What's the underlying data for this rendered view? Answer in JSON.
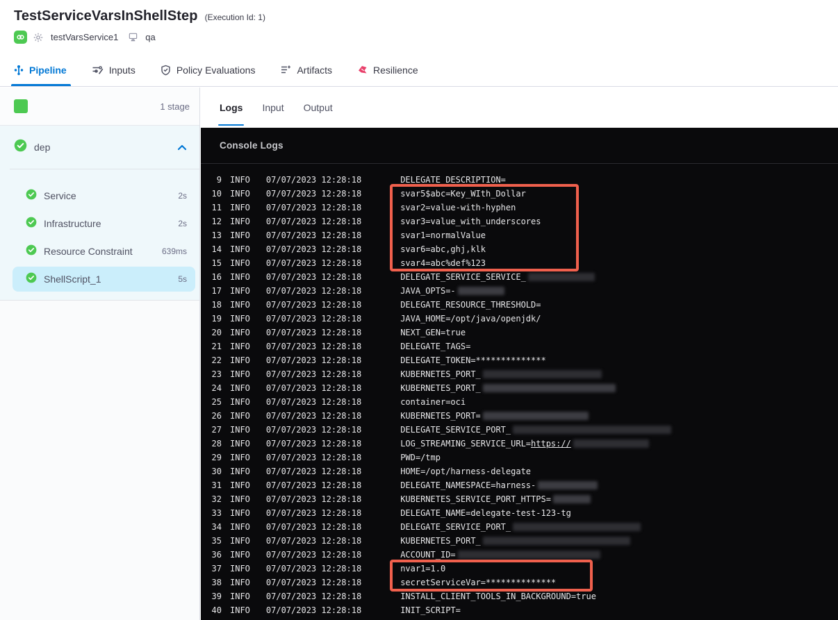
{
  "header": {
    "title": "TestServiceVarsInShellStep",
    "execution_id": "(Execution Id: 1)",
    "service_name": "testVarsService1",
    "environment_name": "qa"
  },
  "tabs": [
    {
      "label": "Pipeline",
      "active": true
    },
    {
      "label": "Inputs",
      "active": false
    },
    {
      "label": "Policy Evaluations",
      "active": false
    },
    {
      "label": "Artifacts",
      "active": false
    },
    {
      "label": "Resilience",
      "active": false
    }
  ],
  "sidebar": {
    "stage_count": "1 stage",
    "stage_name": "dep",
    "steps": [
      {
        "label": "Service",
        "duration": "2s",
        "selected": false
      },
      {
        "label": "Infrastructure",
        "duration": "2s",
        "selected": false
      },
      {
        "label": "Resource Constraint",
        "duration": "639ms",
        "selected": false
      },
      {
        "label": "ShellScript_1",
        "duration": "5s",
        "selected": true
      }
    ]
  },
  "log_panel": {
    "tabs": [
      {
        "label": "Logs",
        "active": true
      },
      {
        "label": "Input",
        "active": false
      },
      {
        "label": "Output",
        "active": false
      }
    ],
    "console_title": "Console Logs"
  },
  "console": {
    "level": "INFO",
    "timestamp": "07/07/2023 12:28:18",
    "lines": [
      {
        "num": "9",
        "segments": [
          "DELEGATE_DESCRIPTION="
        ]
      },
      {
        "num": "10",
        "segments": [
          "svar5$abc=Key_WIth_Dollar"
        ]
      },
      {
        "num": "11",
        "segments": [
          "svar2=value-with-hyphen"
        ]
      },
      {
        "num": "12",
        "segments": [
          "svar3=value_with_underscores"
        ]
      },
      {
        "num": "13",
        "segments": [
          "svar1=normalValue"
        ]
      },
      {
        "num": "14",
        "segments": [
          "svar6=abc,ghj,klk"
        ]
      },
      {
        "num": "15",
        "segments": [
          "svar4=abc%def%123"
        ]
      },
      {
        "num": "16",
        "segments": [
          "DELEGATE_SERVICE_SERVICE_",
          {
            "redact": 96,
            "shade": "dark"
          }
        ]
      },
      {
        "num": "17",
        "segments": [
          "JAVA_OPTS=-",
          {
            "redact": 67
          }
        ]
      },
      {
        "num": "18",
        "segments": [
          "DELEGATE_RESOURCE_THRESHOLD="
        ]
      },
      {
        "num": "19",
        "segments": [
          "JAVA_HOME=/opt/java/openjdk/"
        ]
      },
      {
        "num": "20",
        "segments": [
          "NEXT_GEN=true"
        ]
      },
      {
        "num": "21",
        "segments": [
          "DELEGATE_TAGS="
        ]
      },
      {
        "num": "22",
        "segments": [
          "DELEGATE_TOKEN=**************"
        ]
      },
      {
        "num": "23",
        "segments": [
          "KUBERNETES_PORT_",
          {
            "redact": 171,
            "shade": "dark"
          }
        ]
      },
      {
        "num": "24",
        "segments": [
          "KUBERNETES_PORT_",
          {
            "redact": 191
          }
        ]
      },
      {
        "num": "25",
        "segments": [
          "container=oci"
        ]
      },
      {
        "num": "26",
        "segments": [
          "KUBERNETES_PORT=",
          {
            "redact": 152
          }
        ]
      },
      {
        "num": "27",
        "segments": [
          "DELEGATE_SERVICE_PORT_",
          {
            "redact": 228,
            "shade": "dark"
          }
        ]
      },
      {
        "num": "28",
        "segments": [
          "LOG_STREAMING_SERVICE_URL=",
          {
            "link": "https://"
          },
          {
            "redact": 109,
            "shade": "dark"
          }
        ]
      },
      {
        "num": "29",
        "segments": [
          "PWD=/tmp"
        ]
      },
      {
        "num": "30",
        "segments": [
          "HOME=/opt/harness-delegate"
        ]
      },
      {
        "num": "31",
        "segments": [
          "DELEGATE_NAMESPACE=harness-",
          {
            "redact": 86
          }
        ]
      },
      {
        "num": "32",
        "segments": [
          "KUBERNETES_SERVICE_PORT_HTTPS=",
          {
            "redact": 54
          }
        ]
      },
      {
        "num": "33",
        "segments": [
          "DELEGATE_NAME=delegate-test-123-tg"
        ]
      },
      {
        "num": "34",
        "segments": [
          "DELEGATE_SERVICE_PORT_",
          {
            "redact": 184,
            "shade": "dark"
          }
        ]
      },
      {
        "num": "35",
        "segments": [
          "KUBERNETES_PORT_",
          {
            "redact": 212,
            "shade": "dark"
          }
        ]
      },
      {
        "num": "36",
        "segments": [
          "ACCOUNT_ID=",
          {
            "redact": 205,
            "shade": "dark"
          }
        ]
      },
      {
        "num": "37",
        "segments": [
          "nvar1=1.0"
        ]
      },
      {
        "num": "38",
        "segments": [
          "secretServiceVar=**************"
        ]
      },
      {
        "num": "39",
        "segments": [
          "INSTALL_CLIENT_TOOLS_IN_BACKGROUND=true"
        ]
      },
      {
        "num": "40",
        "segments": [
          "INIT_SCRIPT="
        ]
      }
    ]
  },
  "colors": {
    "accent_blue": "#0278D5",
    "success_green": "#4DC952",
    "highlight_red": "#F0604D",
    "console_bg": "#0A0A0C",
    "selected_step_bg": "#CBEEFB",
    "resilience_pink": "#E9426C"
  }
}
